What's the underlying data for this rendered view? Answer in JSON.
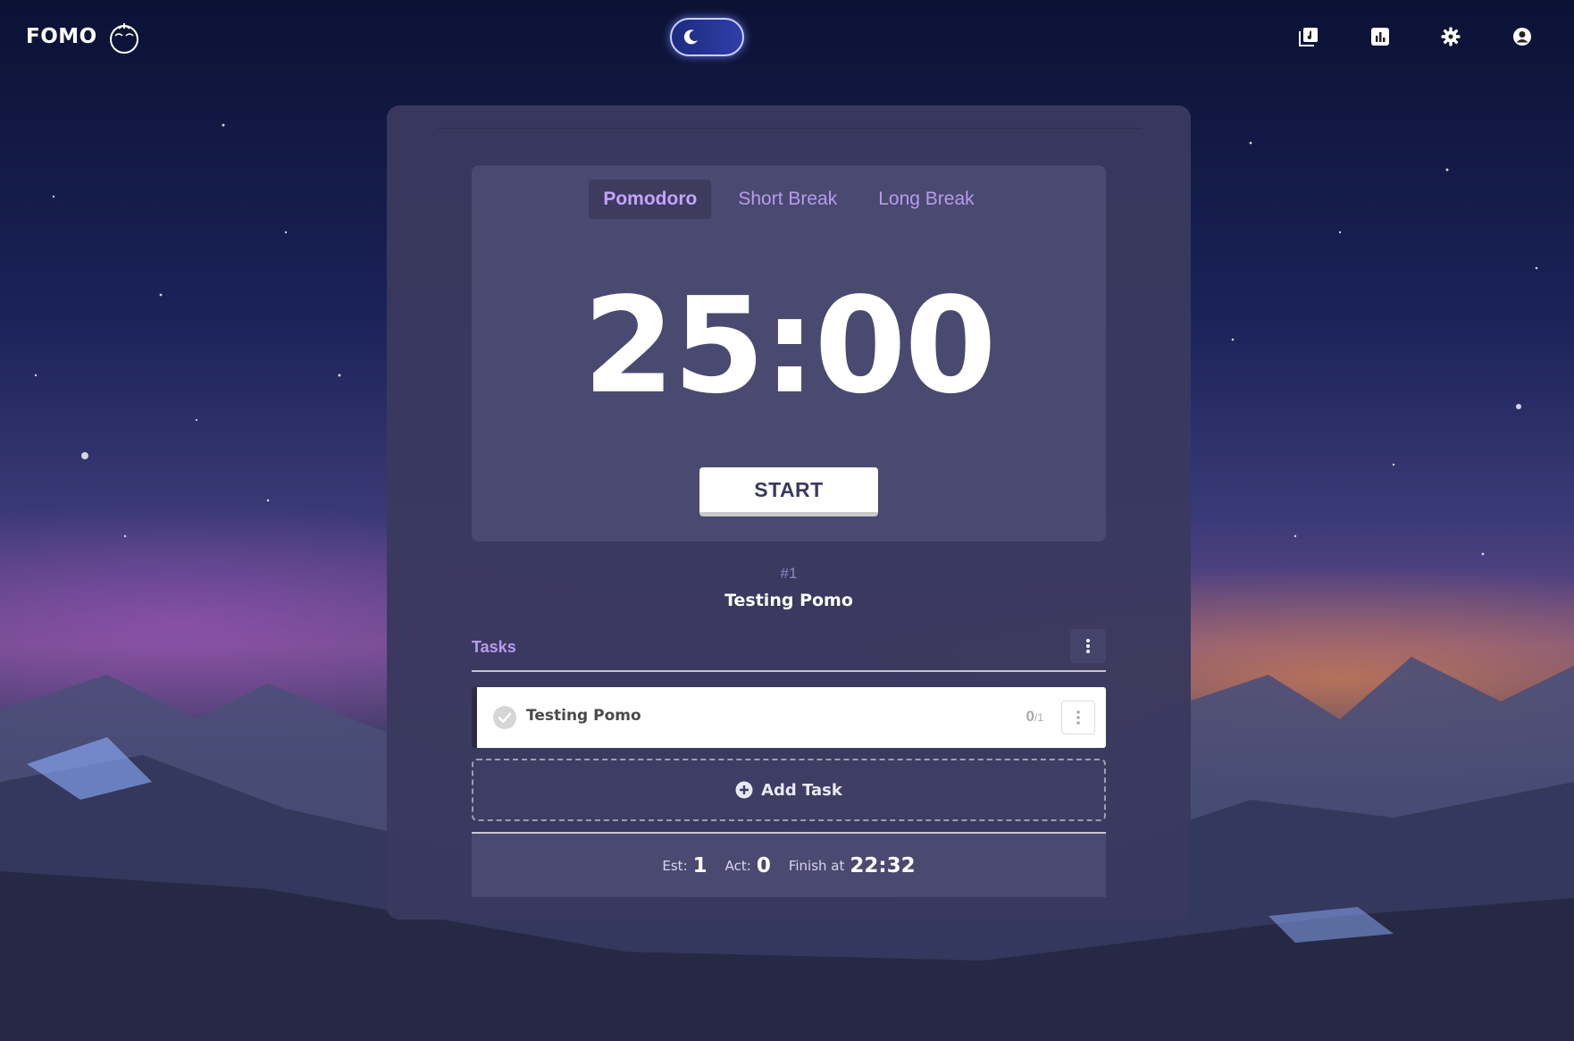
{
  "app": {
    "brand": "FOMO",
    "theme_toggle": {
      "mode": "dark"
    },
    "nav_icons": [
      "music-icon",
      "report-icon",
      "settings-icon",
      "account-icon"
    ]
  },
  "timer": {
    "tabs": [
      {
        "label": "Pomodoro",
        "active": true
      },
      {
        "label": "Short Break",
        "active": false
      },
      {
        "label": "Long Break",
        "active": false
      }
    ],
    "time": "25:00",
    "start_label": "START"
  },
  "session": {
    "round": "#1",
    "current_task": "Testing Pomo"
  },
  "tasks": {
    "title": "Tasks",
    "items": [
      {
        "name": "Testing Pomo",
        "done_count": "0",
        "total_count": "/1"
      }
    ],
    "add_label": "Add Task"
  },
  "summary": {
    "est_label": "Est:",
    "est_value": "1",
    "act_label": "Act:",
    "act_value": "0",
    "finish_label": "Finish at",
    "finish_value": "22:32"
  },
  "colors": {
    "accent": "#b99af0",
    "card": "#3a395e",
    "timer_box": "#4a4970"
  }
}
